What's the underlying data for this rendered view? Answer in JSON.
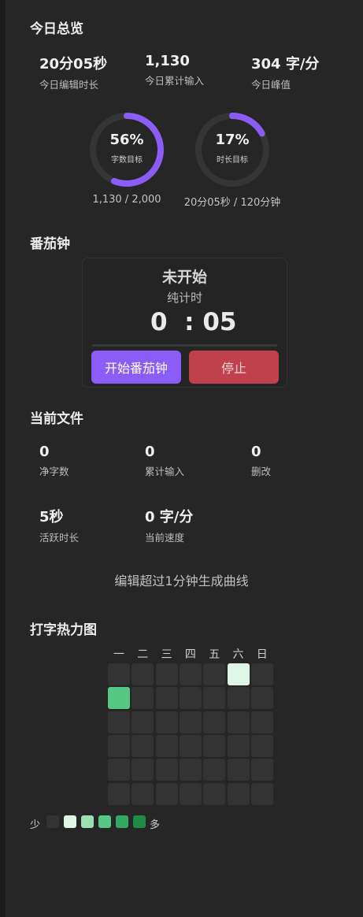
{
  "overview": {
    "title": "今日总览",
    "stats": [
      {
        "value": "20分05秒",
        "label": "今日编辑时长"
      },
      {
        "value": "1,130",
        "label": "今日累计输入"
      },
      {
        "value": "304 字/分",
        "label": "今日峰值"
      }
    ],
    "rings": [
      {
        "percent_text": "56%",
        "percent": 56,
        "sub": "字数目标",
        "caption": "1,130 / 2,000"
      },
      {
        "percent_text": "17%",
        "percent": 17,
        "sub": "时长目标",
        "caption": "20分05秒 / 120分钟"
      }
    ]
  },
  "pomodoro": {
    "title": "番茄钟",
    "state": "未开始",
    "mode": "纯计时",
    "time": "0  : 05",
    "progress": 0,
    "start_label": "开始番茄钟",
    "stop_label": "停止"
  },
  "current_file": {
    "title": "当前文件",
    "stats": [
      {
        "value": "0",
        "label": "净字数"
      },
      {
        "value": "0",
        "label": "累计输入"
      },
      {
        "value": "0",
        "label": "删改"
      },
      {
        "value": "5秒",
        "label": "活跃时长"
      },
      {
        "value": "0 字/分",
        "label": "当前速度"
      }
    ],
    "curve_hint": "编辑超过1分钟生成曲线"
  },
  "heatmap": {
    "title": "打字热力图",
    "weekdays": [
      "一",
      "二",
      "三",
      "四",
      "五",
      "六",
      "日"
    ],
    "levels": [
      [
        0,
        0,
        0,
        0,
        0,
        1,
        0
      ],
      [
        3,
        0,
        0,
        0,
        0,
        0,
        0
      ],
      [
        0,
        0,
        0,
        0,
        0,
        0,
        0
      ],
      [
        0,
        0,
        0,
        0,
        0,
        0,
        0
      ],
      [
        0,
        0,
        0,
        0,
        0,
        0,
        0
      ],
      [
        0,
        0,
        0,
        0,
        0,
        0,
        0
      ]
    ],
    "legend_less": "少",
    "legend_more": "多",
    "colors": [
      "#333333",
      "#dff5e6",
      "#9be0b1",
      "#56c784",
      "#33a862",
      "#1f8a48"
    ],
    "accent": "#8b5cf6"
  }
}
